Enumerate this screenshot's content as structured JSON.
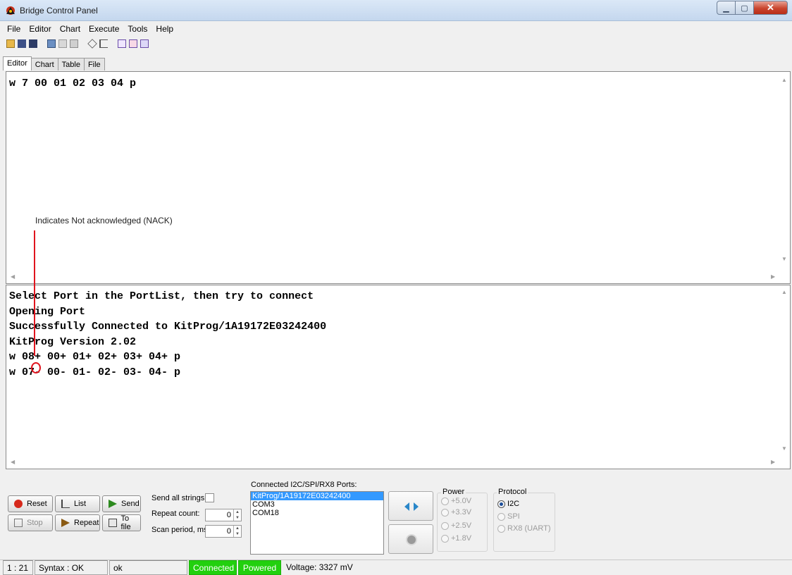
{
  "window": {
    "title": "Bridge Control Panel"
  },
  "menu": [
    "File",
    "Editor",
    "Chart",
    "Execute",
    "Tools",
    "Help"
  ],
  "tabs": [
    "Editor",
    "Chart",
    "Table",
    "File"
  ],
  "editor": {
    "text": "w 7 00 01 02 03 04 p"
  },
  "annotation": {
    "label": "Indicates Not acknowledged (NACK)"
  },
  "output": {
    "lines": [
      "Select Port in the PortList, then try to connect",
      "Opening Port",
      "Successfully Connected to KitProg/1A19172E03242400",
      "KitProg Version 2.02",
      "w 08+ 00+ 01+ 02+ 03+ 04+ p",
      "w 07- 00- 01- 02- 03- 04- p"
    ]
  },
  "controls": {
    "reset": "Reset",
    "list": "List",
    "send": "Send",
    "stop": "Stop",
    "repeat": "Repeat",
    "to_file": "To file",
    "send_all_strings": "Send all strings:",
    "repeat_count": "Repeat count:",
    "repeat_count_value": "0",
    "scan_period": "Scan period, ms:",
    "scan_period_value": "0",
    "ports_title": "Connected I2C/SPI/RX8 Ports:",
    "ports": [
      "KitProg/1A19172E03242400",
      "COM3",
      "COM18"
    ],
    "power_title": "Power",
    "power_options": [
      "+5.0V",
      "+3.3V",
      "+2.5V",
      "+1.8V"
    ],
    "protocol_title": "Protocol",
    "protocol_options": [
      "I2C",
      "SPI",
      "RX8 (UART)"
    ],
    "protocol_selected": "I2C"
  },
  "status": {
    "position": "1 : 21",
    "syntax": "Syntax : OK",
    "message": "ok",
    "connected": "Connected",
    "powered": "Powered",
    "voltage": "Voltage: 3327 mV"
  },
  "colors": {
    "status_green": "#22d00e",
    "annotation_red": "#e0141e",
    "selection_blue": "#3399ff"
  },
  "icons": [
    "bridge-app-icon",
    "minimize-icon",
    "maximize-icon",
    "close-icon",
    "reset-icon",
    "list-icon",
    "send-icon",
    "stop-icon",
    "repeat-icon",
    "to-file-icon",
    "connect-icon",
    "power-icon"
  ]
}
